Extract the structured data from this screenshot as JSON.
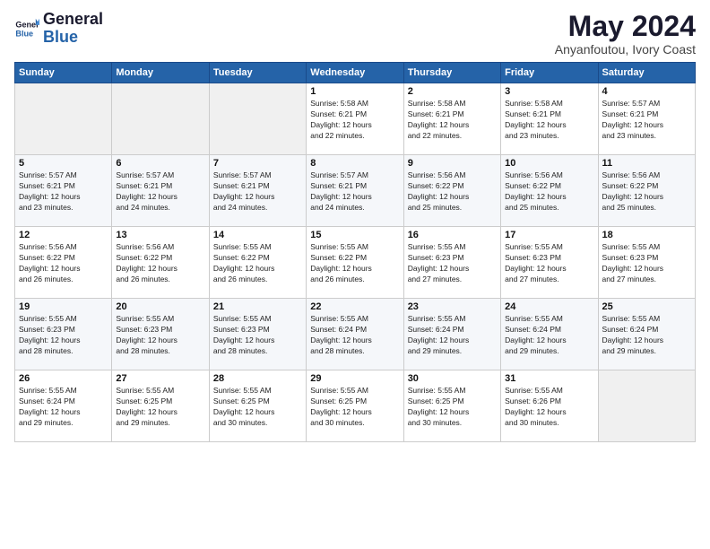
{
  "logo": {
    "line1": "General",
    "line2": "Blue"
  },
  "calendar": {
    "title": "May 2024",
    "subtitle": "Anyanfoutou, Ivory Coast"
  },
  "headers": [
    "Sunday",
    "Monday",
    "Tuesday",
    "Wednesday",
    "Thursday",
    "Friday",
    "Saturday"
  ],
  "weeks": [
    [
      {
        "day": "",
        "info": ""
      },
      {
        "day": "",
        "info": ""
      },
      {
        "day": "",
        "info": ""
      },
      {
        "day": "1",
        "info": "Sunrise: 5:58 AM\nSunset: 6:21 PM\nDaylight: 12 hours\nand 22 minutes."
      },
      {
        "day": "2",
        "info": "Sunrise: 5:58 AM\nSunset: 6:21 PM\nDaylight: 12 hours\nand 22 minutes."
      },
      {
        "day": "3",
        "info": "Sunrise: 5:58 AM\nSunset: 6:21 PM\nDaylight: 12 hours\nand 23 minutes."
      },
      {
        "day": "4",
        "info": "Sunrise: 5:57 AM\nSunset: 6:21 PM\nDaylight: 12 hours\nand 23 minutes."
      }
    ],
    [
      {
        "day": "5",
        "info": "Sunrise: 5:57 AM\nSunset: 6:21 PM\nDaylight: 12 hours\nand 23 minutes."
      },
      {
        "day": "6",
        "info": "Sunrise: 5:57 AM\nSunset: 6:21 PM\nDaylight: 12 hours\nand 24 minutes."
      },
      {
        "day": "7",
        "info": "Sunrise: 5:57 AM\nSunset: 6:21 PM\nDaylight: 12 hours\nand 24 minutes."
      },
      {
        "day": "8",
        "info": "Sunrise: 5:57 AM\nSunset: 6:21 PM\nDaylight: 12 hours\nand 24 minutes."
      },
      {
        "day": "9",
        "info": "Sunrise: 5:56 AM\nSunset: 6:22 PM\nDaylight: 12 hours\nand 25 minutes."
      },
      {
        "day": "10",
        "info": "Sunrise: 5:56 AM\nSunset: 6:22 PM\nDaylight: 12 hours\nand 25 minutes."
      },
      {
        "day": "11",
        "info": "Sunrise: 5:56 AM\nSunset: 6:22 PM\nDaylight: 12 hours\nand 25 minutes."
      }
    ],
    [
      {
        "day": "12",
        "info": "Sunrise: 5:56 AM\nSunset: 6:22 PM\nDaylight: 12 hours\nand 26 minutes."
      },
      {
        "day": "13",
        "info": "Sunrise: 5:56 AM\nSunset: 6:22 PM\nDaylight: 12 hours\nand 26 minutes."
      },
      {
        "day": "14",
        "info": "Sunrise: 5:55 AM\nSunset: 6:22 PM\nDaylight: 12 hours\nand 26 minutes."
      },
      {
        "day": "15",
        "info": "Sunrise: 5:55 AM\nSunset: 6:22 PM\nDaylight: 12 hours\nand 26 minutes."
      },
      {
        "day": "16",
        "info": "Sunrise: 5:55 AM\nSunset: 6:23 PM\nDaylight: 12 hours\nand 27 minutes."
      },
      {
        "day": "17",
        "info": "Sunrise: 5:55 AM\nSunset: 6:23 PM\nDaylight: 12 hours\nand 27 minutes."
      },
      {
        "day": "18",
        "info": "Sunrise: 5:55 AM\nSunset: 6:23 PM\nDaylight: 12 hours\nand 27 minutes."
      }
    ],
    [
      {
        "day": "19",
        "info": "Sunrise: 5:55 AM\nSunset: 6:23 PM\nDaylight: 12 hours\nand 28 minutes."
      },
      {
        "day": "20",
        "info": "Sunrise: 5:55 AM\nSunset: 6:23 PM\nDaylight: 12 hours\nand 28 minutes."
      },
      {
        "day": "21",
        "info": "Sunrise: 5:55 AM\nSunset: 6:23 PM\nDaylight: 12 hours\nand 28 minutes."
      },
      {
        "day": "22",
        "info": "Sunrise: 5:55 AM\nSunset: 6:24 PM\nDaylight: 12 hours\nand 28 minutes."
      },
      {
        "day": "23",
        "info": "Sunrise: 5:55 AM\nSunset: 6:24 PM\nDaylight: 12 hours\nand 29 minutes."
      },
      {
        "day": "24",
        "info": "Sunrise: 5:55 AM\nSunset: 6:24 PM\nDaylight: 12 hours\nand 29 minutes."
      },
      {
        "day": "25",
        "info": "Sunrise: 5:55 AM\nSunset: 6:24 PM\nDaylight: 12 hours\nand 29 minutes."
      }
    ],
    [
      {
        "day": "26",
        "info": "Sunrise: 5:55 AM\nSunset: 6:24 PM\nDaylight: 12 hours\nand 29 minutes."
      },
      {
        "day": "27",
        "info": "Sunrise: 5:55 AM\nSunset: 6:25 PM\nDaylight: 12 hours\nand 29 minutes."
      },
      {
        "day": "28",
        "info": "Sunrise: 5:55 AM\nSunset: 6:25 PM\nDaylight: 12 hours\nand 30 minutes."
      },
      {
        "day": "29",
        "info": "Sunrise: 5:55 AM\nSunset: 6:25 PM\nDaylight: 12 hours\nand 30 minutes."
      },
      {
        "day": "30",
        "info": "Sunrise: 5:55 AM\nSunset: 6:25 PM\nDaylight: 12 hours\nand 30 minutes."
      },
      {
        "day": "31",
        "info": "Sunrise: 5:55 AM\nSunset: 6:26 PM\nDaylight: 12 hours\nand 30 minutes."
      },
      {
        "day": "",
        "info": ""
      }
    ]
  ]
}
